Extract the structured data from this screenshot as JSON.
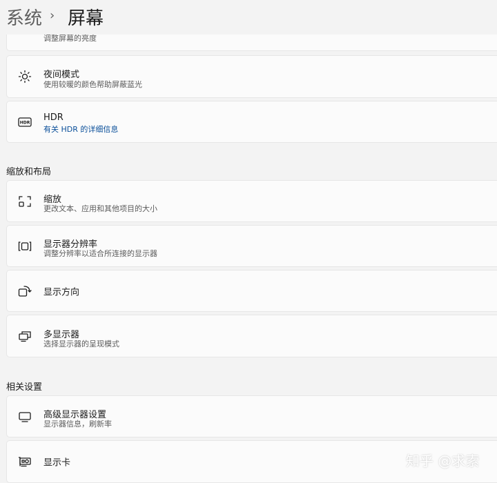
{
  "breadcrumb": {
    "root": "系统",
    "separator": "›",
    "current": "屏幕"
  },
  "cards_top": [
    {
      "id": "brightness",
      "title": "",
      "desc": "调整屏幕的亮度"
    },
    {
      "id": "night",
      "title": "夜间模式",
      "desc": "使用较暖的颜色帮助屏蔽蓝光"
    },
    {
      "id": "hdr",
      "title": "HDR",
      "desc": "有关 HDR 的详细信息",
      "icon_text": "HDR"
    }
  ],
  "sections": [
    {
      "title": "缩放和布局"
    },
    {
      "title": "相关设置"
    }
  ],
  "cards_layout": [
    {
      "id": "scale",
      "title": "缩放",
      "desc": "更改文本、应用和其他项目的大小"
    },
    {
      "id": "resolution",
      "title": "显示器分辨率",
      "desc": "调整分辨率以适合所连接的显示器"
    },
    {
      "id": "orientation",
      "title": "显示方向",
      "desc": ""
    },
    {
      "id": "multi",
      "title": "多显示器",
      "desc": "选择显示器的呈现模式"
    }
  ],
  "cards_related": [
    {
      "id": "advanced",
      "title": "高级显示器设置",
      "desc": "显示器信息，刷新率"
    },
    {
      "id": "gpu",
      "title": "显示卡",
      "desc": ""
    }
  ],
  "watermark": "知乎 @求索",
  "colors": {
    "link": "#0a4f9a",
    "background": "#f3f3f3",
    "card": "#fbfbfb"
  }
}
